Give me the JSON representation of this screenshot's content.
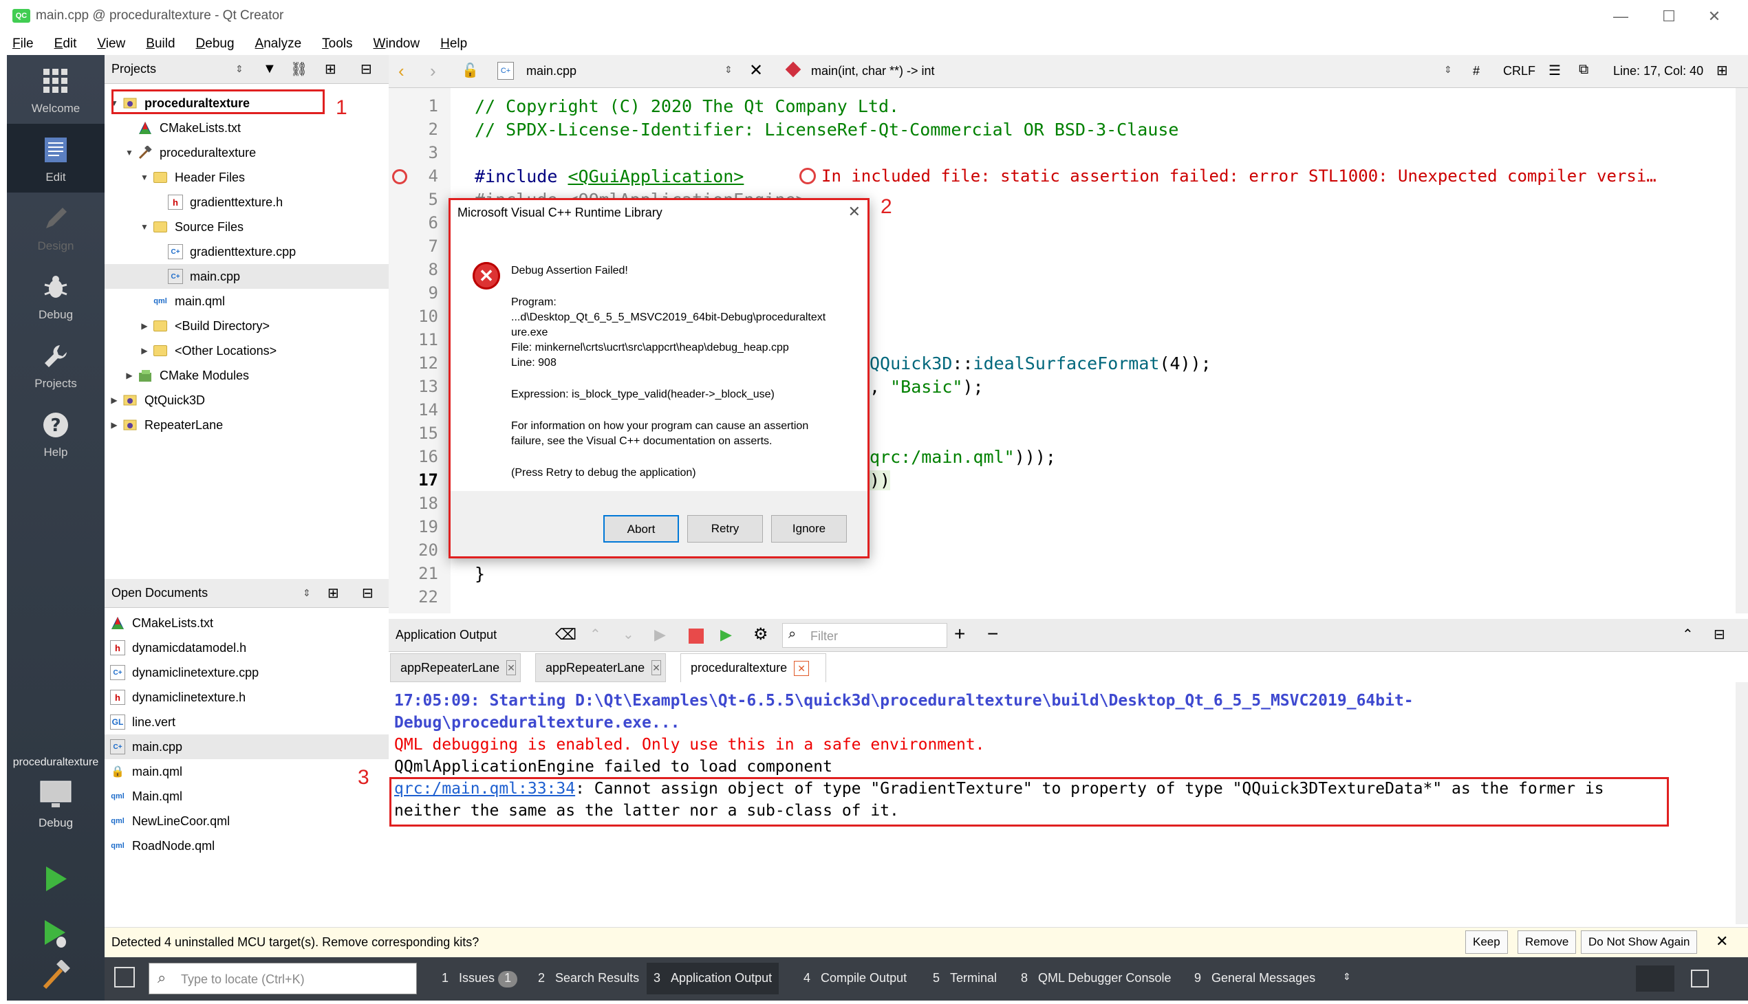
{
  "window": {
    "app_icon": "qt-logo-icon",
    "title": "main.cpp @ proceduraltexture - Qt Creator",
    "controls": {
      "minimize": "—",
      "maximize": "☐",
      "close": "✕"
    }
  },
  "menubar": [
    "File",
    "Edit",
    "View",
    "Build",
    "Debug",
    "Analyze",
    "Tools",
    "Window",
    "Help"
  ],
  "modes": [
    {
      "label": "Welcome",
      "icon": "grid-icon"
    },
    {
      "label": "Edit",
      "icon": "document-icon"
    },
    {
      "label": "Design",
      "icon": "pen-icon"
    },
    {
      "label": "Debug",
      "icon": "bug-icon"
    },
    {
      "label": "Projects",
      "icon": "wrench-icon"
    },
    {
      "label": "Help",
      "icon": "help-icon"
    }
  ],
  "target": {
    "project": "proceduraltexture",
    "kit": "Debug"
  },
  "projects_panel": {
    "title": "Projects",
    "tree": [
      {
        "label": "proceduraltexture",
        "indent": 0,
        "arrow": "▼",
        "icon": "qt-project-icon",
        "bold": true
      },
      {
        "label": "CMakeLists.txt",
        "indent": 1,
        "arrow": "",
        "icon": "cmake-icon"
      },
      {
        "label": "proceduraltexture",
        "indent": 1,
        "arrow": "▼",
        "icon": "hammer-icon"
      },
      {
        "label": "Header Files",
        "indent": 2,
        "arrow": "▼",
        "icon": "folder-icon"
      },
      {
        "label": "gradienttexture.h",
        "indent": 3,
        "arrow": "",
        "icon": "h-file-icon"
      },
      {
        "label": "Source Files",
        "indent": 2,
        "arrow": "▼",
        "icon": "folder-icon"
      },
      {
        "label": "gradienttexture.cpp",
        "indent": 3,
        "arrow": "",
        "icon": "cpp-file-icon"
      },
      {
        "label": "main.cpp",
        "indent": 3,
        "arrow": "",
        "icon": "cpp-file-icon",
        "selected": true
      },
      {
        "label": "main.qml",
        "indent": 2,
        "arrow": "",
        "icon": "qml-file-icon"
      },
      {
        "label": "<Build Directory>",
        "indent": 2,
        "arrow": "▶",
        "icon": "folder-icon"
      },
      {
        "label": "<Other Locations>",
        "indent": 2,
        "arrow": "▶",
        "icon": "folder-icon"
      },
      {
        "label": "CMake Modules",
        "indent": 1,
        "arrow": "▶",
        "icon": "cmake-modules-icon"
      },
      {
        "label": "QtQuick3D",
        "indent": 0,
        "arrow": "▶",
        "icon": "qt-project-icon"
      },
      {
        "label": "RepeaterLane",
        "indent": 0,
        "arrow": "▶",
        "icon": "qt-project-icon"
      }
    ]
  },
  "open_documents": {
    "title": "Open Documents",
    "items": [
      {
        "label": "CMakeLists.txt",
        "icon": "cmake-icon"
      },
      {
        "label": "dynamicdatamodel.h",
        "icon": "h-file-icon"
      },
      {
        "label": "dynamiclinetexture.cpp",
        "icon": "cpp-file-icon"
      },
      {
        "label": "dynamiclinetexture.h",
        "icon": "h-file-icon"
      },
      {
        "label": "line.vert",
        "icon": "glsl-file-icon"
      },
      {
        "label": "main.cpp",
        "icon": "cpp-file-icon",
        "selected": true
      },
      {
        "label": "main.qml",
        "icon": "lock-icon"
      },
      {
        "label": "Main.qml",
        "icon": "qml-file-icon"
      },
      {
        "label": "NewLineCoor.qml",
        "icon": "qml-file-icon"
      },
      {
        "label": "RoadNode.qml",
        "icon": "qml-file-icon"
      }
    ]
  },
  "editor": {
    "file": "main.cpp",
    "symbol": "main(int, char **) -> int",
    "hash": "#",
    "line_ending": "CRLF",
    "position": "Line: 17, Col: 40",
    "lines": [
      "1",
      "2",
      "3",
      "4",
      "5",
      "6",
      "7",
      "8",
      "9",
      "10",
      "11",
      "12",
      "13",
      "14",
      "15",
      "16",
      "17",
      "18",
      "19",
      "20",
      "21",
      "22"
    ],
    "code": {
      "l1": "// Copyright (C) 2020 The Qt Company Ltd.",
      "l2": "// SPDX-License-Identifier: LicenseRef-Qt-Commercial OR BSD-3-Clause",
      "l4_include": "#include",
      "l4_header": "<QGuiApplication>",
      "l4_error": "In included file: static assertion failed: error STL1000: Unexpected compiler versi…",
      "l12_class": "QQuick3D",
      "l12_sep": "::",
      "l12_fn": "idealSurfaceFormat",
      "l12_rest": "(4));",
      "l13_pre": ", ",
      "l13_str": "\"Basic\"",
      "l13_post": ");",
      "l16_str": "qrc:/main.qml\"",
      "l16_post": ")));",
      "l17": "))",
      "l21": "}"
    }
  },
  "dialog": {
    "title": "Microsoft Visual C++ Runtime Library",
    "heading": "Debug Assertion Failed!",
    "program_label": "Program:",
    "program_path_1": "...d\\Desktop_Qt_6_5_5_MSVC2019_64bit-Debug\\proceduraltext",
    "program_path_2": "ure.exe",
    "file": "File: minkernel\\crts\\ucrt\\src\\appcrt\\heap\\debug_heap.cpp",
    "line": "Line: 908",
    "expression": "Expression: is_block_type_valid(header->_block_use)",
    "info_1": "For information on how your program can cause an assertion",
    "info_2": "failure, see the Visual C++ documentation on asserts.",
    "press": "(Press Retry to debug the application)",
    "buttons": {
      "abort": "Abort",
      "retry": "Retry",
      "ignore": "Ignore"
    }
  },
  "output": {
    "title": "Application Output",
    "filter_placeholder": "Filter",
    "tabs": [
      "appRepeaterLane",
      "appRepeaterLane",
      "proceduraltexture"
    ],
    "lines": {
      "start_1": "17:05:09: Starting D:\\Qt\\Examples\\Qt-6.5.5\\quick3d\\proceduraltexture\\build\\Desktop_Qt_6_5_5_MSVC2019_64bit-",
      "start_2": "Debug\\proceduraltexture.exe...",
      "qml_debug": "QML debugging is enabled. Only use this in a safe environment.",
      "engine": "QQmlApplicationEngine failed to load component",
      "err_link": "qrc:/main.qml:33:34",
      "err_msg": ": Cannot assign object of type \"GradientTexture\" to property of type \"QQuick3DTextureData*\" as the former is",
      "err_msg_2": "neither the same as the latter nor a sub-class of it."
    }
  },
  "annotations": [
    "1",
    "2",
    "3"
  ],
  "notification": {
    "text": "Detected 4 uninstalled MCU target(s). Remove corresponding kits?",
    "keep": "Keep",
    "remove": "Remove",
    "dont_show": "Do Not Show Again"
  },
  "statusbar": {
    "locate_placeholder": "Type to locate (Ctrl+K)",
    "issues_num": "1",
    "issues_label": "Issues",
    "issues_count": "1",
    "search_num": "2",
    "search_label": "Search Results",
    "appout_num": "3",
    "appout_label": "Application Output",
    "compile_num": "4",
    "compile_label": "Compile Output",
    "terminal_num": "5",
    "terminal_label": "Terminal",
    "qmldbg_num": "8",
    "qmldbg_label": "QML Debugger Console",
    "general_num": "9",
    "general_label": "General Messages"
  }
}
